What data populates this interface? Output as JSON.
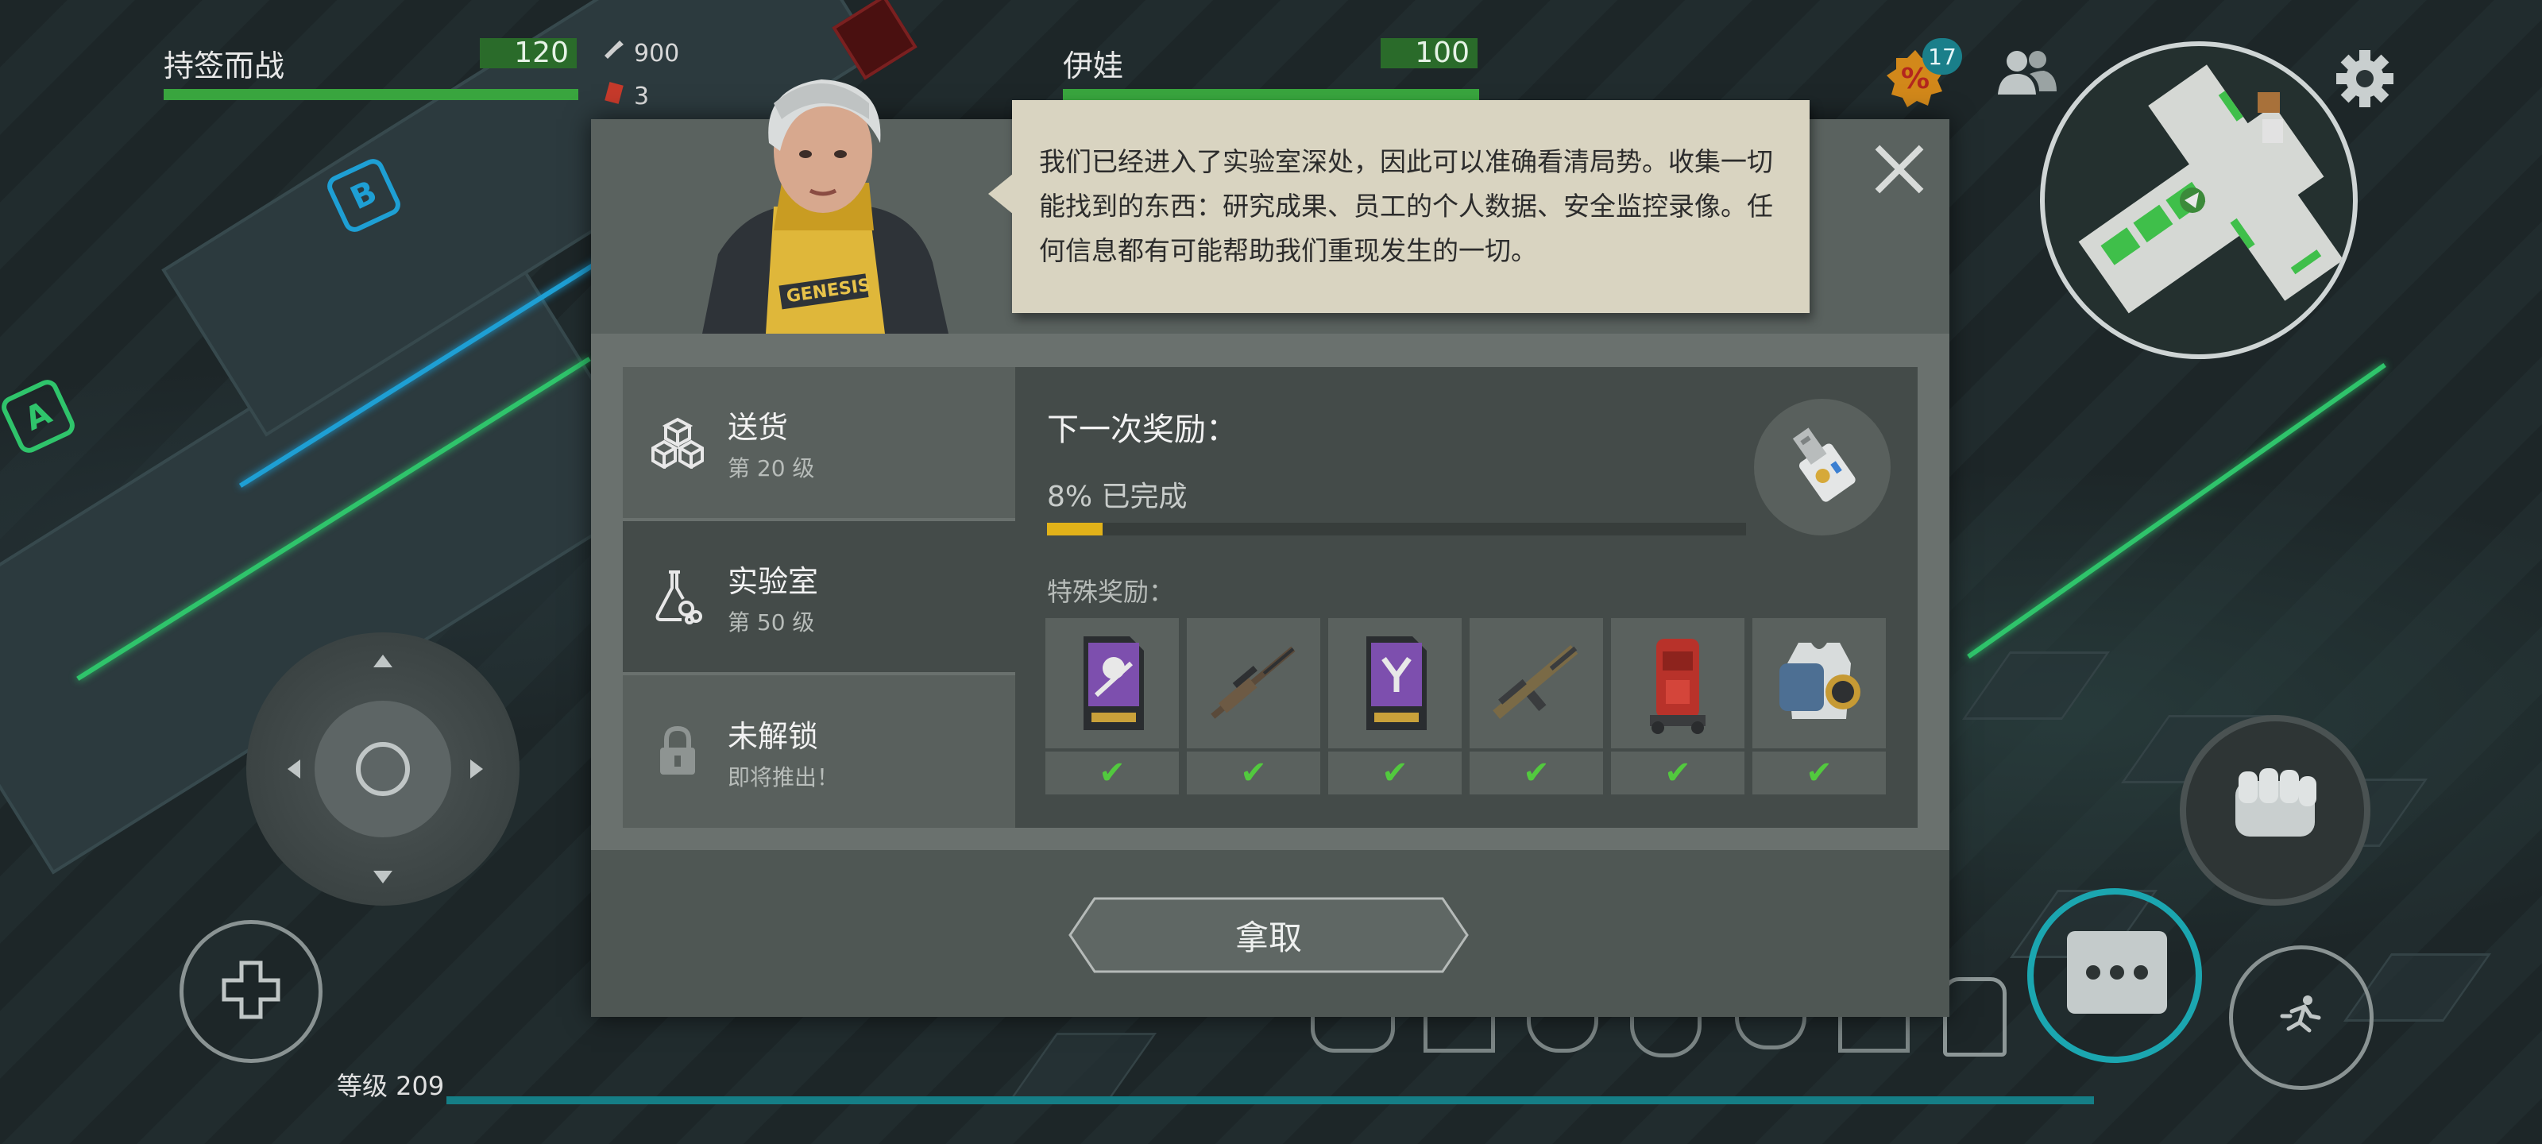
{
  "players": [
    {
      "name": "持签而战",
      "hp": "120"
    },
    {
      "name": "伊娃",
      "hp": "100"
    }
  ],
  "resources": [
    {
      "icon": "gun-parts-icon",
      "value": "900"
    },
    {
      "icon": "red-card-icon",
      "value": "3"
    }
  ],
  "top_right": {
    "discount_badge": "17",
    "discount_icon": "percent-icon"
  },
  "dialog": {
    "speech": "我们已经进入了实验室深处，因此可以准确看清局势。收集一切能找到的东西：研究成果、员工的个人数据、安全监控录像。任何信息都有可能帮助我们重现发生的一切。",
    "character_badge": "GENESIS",
    "tabs": [
      {
        "title": "送货",
        "subtitle": "第 20 级",
        "icon": "boxes-icon"
      },
      {
        "title": "实验室",
        "subtitle": "第 50 级",
        "icon": "flask-icon"
      },
      {
        "title": "未解锁",
        "subtitle": "即将推出！",
        "icon": "lock-icon"
      }
    ],
    "next_reward_label": "下一次奖励：",
    "progress_label": "8% 已完成",
    "progress_fraction": 0.08,
    "special_label": "特殊奖励：",
    "rewards": [
      {
        "name": "skull-card-icon"
      },
      {
        "name": "sniper-rifle-icon"
      },
      {
        "name": "drop-card-icon"
      },
      {
        "name": "assault-rifle-icon"
      },
      {
        "name": "red-backpack-icon"
      },
      {
        "name": "armor-vest-icon"
      }
    ],
    "take_button": "拿取"
  },
  "level_label": "等级 209",
  "colors": {
    "accent": "#e2b219",
    "check": "#52c93e",
    "hp_bar": "#39a53e",
    "xp_bar": "#157e86"
  }
}
